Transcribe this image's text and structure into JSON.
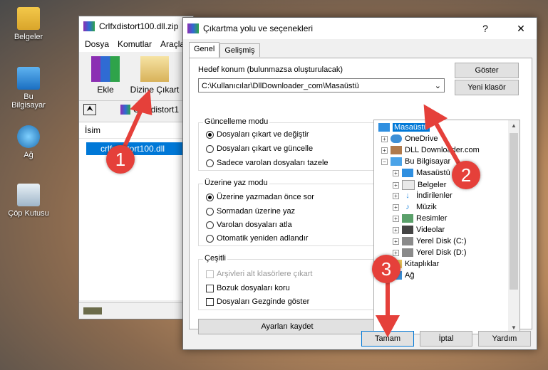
{
  "desktop": {
    "icons": [
      {
        "label": "Belgeler",
        "icon": "documents-folder-icon"
      },
      {
        "label": "Bu Bilgisayar",
        "icon": "computer-icon"
      },
      {
        "label": "Ağ",
        "icon": "network-icon"
      },
      {
        "label": "Çöp Kutusu",
        "icon": "recycle-bin-icon"
      }
    ]
  },
  "winrar": {
    "title": "Crlfxdistort100.dll.zip",
    "menu": [
      "Dosya",
      "Komutlar",
      "Araçla"
    ],
    "toolbar": {
      "add": "Ekle",
      "extract": "Dizine Çıkart"
    },
    "address": "Crlfxdistort1",
    "list_header": "İsim",
    "file": "crlfxdistort100.dll"
  },
  "dialog": {
    "title": "Çıkartma yolu ve seçenekleri",
    "help": "?",
    "close": "✕",
    "tabs": [
      "Genel",
      "Gelişmiş"
    ],
    "dest_label": "Hedef konum (bulunmazsa oluşturulacak)",
    "dest_value": "C:\\Kullanıcılar\\DllDownloader_com\\Masaüstü",
    "btn_show": "Göster",
    "btn_new_folder": "Yeni klasör",
    "update_mode": {
      "title": "Güncelleme modu",
      "options": [
        "Dosyaları çıkart ve değiştir",
        "Dosyaları çıkart ve güncelle",
        "Sadece varolan dosyaları tazele"
      ],
      "selected": 0
    },
    "overwrite_mode": {
      "title": "Üzerine yaz modu",
      "options": [
        "Üzerine yazmadan önce sor",
        "Sormadan üzerine yaz",
        "Varolan dosyaları atla",
        "Otomatik yeniden adlandır"
      ],
      "selected": 0
    },
    "misc": {
      "title": "Çeşitli",
      "options": [
        "Arşivleri alt klasörlere çıkart",
        "Bozuk dosyaları koru",
        "Dosyaları Gezginde göster"
      ]
    },
    "btn_save": "Ayarları kaydet",
    "tree": [
      {
        "label": "Masaüstü",
        "selected": true
      },
      {
        "label": "OneDrive"
      },
      {
        "label": "DLL Downloader.com"
      },
      {
        "label": "Bu Bilgisayar"
      },
      {
        "label": "Masaüstü"
      },
      {
        "label": "Belgeler"
      },
      {
        "label": "İndirilenler"
      },
      {
        "label": "Müzik"
      },
      {
        "label": "Resimler"
      },
      {
        "label": "Videolar"
      },
      {
        "label": "Yerel Disk (C:)"
      },
      {
        "label": "Yerel Disk (D:)"
      },
      {
        "label": "Kitaplıklar"
      },
      {
        "label": "Ağ"
      }
    ],
    "btn_ok": "Tamam",
    "btn_cancel": "İptal",
    "btn_help": "Yardım"
  },
  "annotations": [
    "1",
    "2",
    "3"
  ],
  "colors": {
    "accent": "#0078d7",
    "badge": "#e5403a"
  }
}
